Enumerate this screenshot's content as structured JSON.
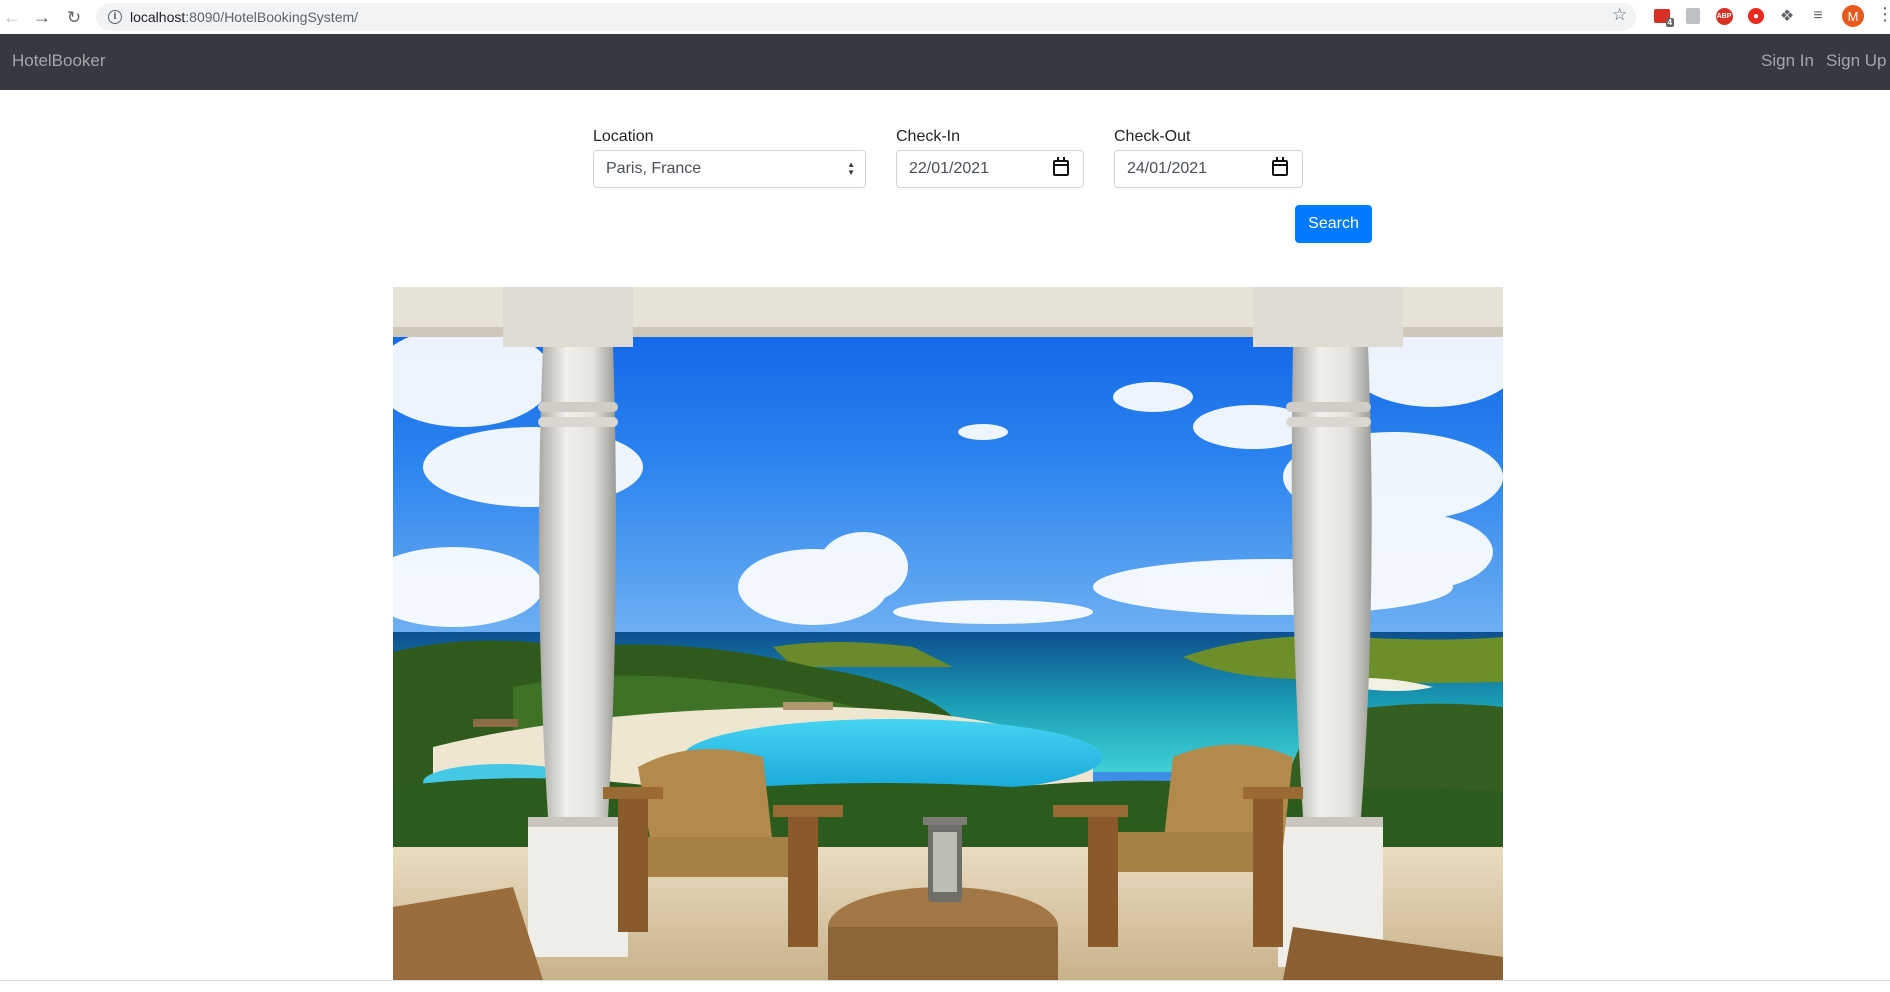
{
  "browser": {
    "url_host": "localhost",
    "url_rest": ":8090/HotelBookingSystem/",
    "extension_badge": "4",
    "abp_label": "ABP",
    "profile_initial": "M",
    "icons": [
      "back-icon",
      "forward-icon",
      "reload-icon",
      "info-icon",
      "star-icon",
      "extension-icon",
      "puzzle-icon",
      "reading-list-icon",
      "menu-icon"
    ]
  },
  "navbar": {
    "brand": "HotelBooker",
    "sign_in": "Sign In",
    "sign_up": "Sign Up",
    "background": "#343a40"
  },
  "search": {
    "location_label": "Location",
    "location_value": "Paris, France",
    "checkin_label": "Check-In",
    "checkin_value": "22/01/2021",
    "checkout_label": "Check-Out",
    "checkout_value": "24/01/2021",
    "button_label": "Search",
    "button_color": "#007bff"
  },
  "hero": {
    "subject": "terrace-ocean-view-image"
  }
}
